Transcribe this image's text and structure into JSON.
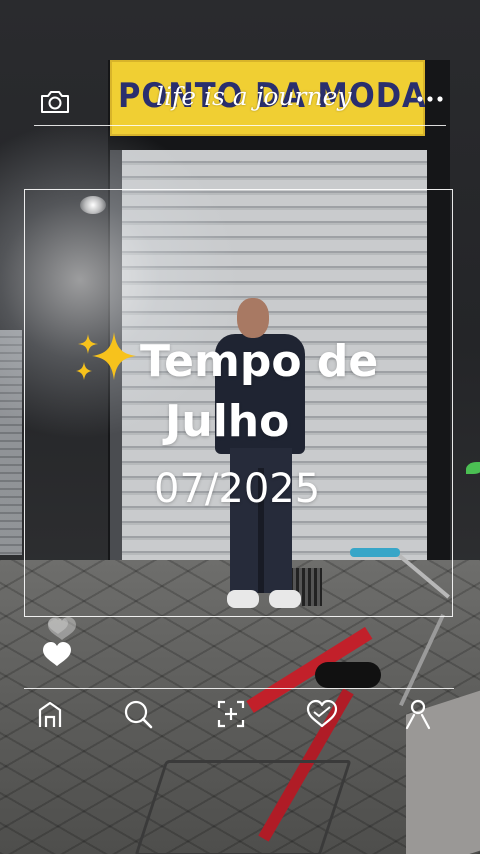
{
  "header": {
    "camera_icon": "camera-icon",
    "tagline": "life is a journey",
    "more_icon": "more-dots-icon"
  },
  "background": {
    "sign_text": "PONTO DA MODA"
  },
  "post": {
    "title_emoji": "sparkles-icon",
    "title_line1": "Tempo de",
    "title_line2": "Julho",
    "date": "07/2025",
    "like_icon": "heart-icon"
  },
  "nav": {
    "items": [
      {
        "name": "home",
        "icon": "home-icon"
      },
      {
        "name": "search",
        "icon": "search-icon"
      },
      {
        "name": "add",
        "icon": "add-icon"
      },
      {
        "name": "likes",
        "icon": "heart-icon"
      },
      {
        "name": "profile",
        "icon": "profile-icon"
      }
    ]
  },
  "colors": {
    "overlay": "#ffffff",
    "sign_yellow": "#f0cf33",
    "sign_text": "#2a2f6e",
    "sparkle": "#f7c21c"
  }
}
